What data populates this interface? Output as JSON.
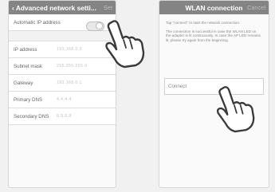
{
  "left_screen": {
    "back_label": "Advanced network setti...",
    "side_button": "Set",
    "auto_ip": {
      "label": "Automatic IP address",
      "toggle_value": "O"
    },
    "fields": [
      {
        "label": "IP address",
        "value": "192.168.0.3"
      },
      {
        "label": "Subnet mask",
        "value": "255.255.255.0"
      },
      {
        "label": "Gateway",
        "value": "192.168.0.1"
      },
      {
        "label": "Primary DNS",
        "value": "4.4.4.4"
      },
      {
        "label": "Secondary DNS",
        "value": "8.8.8.8"
      }
    ]
  },
  "right_screen": {
    "title": "WLAN connection",
    "side_button": "Cancel",
    "note_1": "Tap \"connect\" to start the network connection.",
    "note_2": "The connection is successful in case the WLAN LED on the adapter is lit continuously. In case the AP LED remains lit, please try again from the beginning.",
    "connect_label": "Connect"
  },
  "icons": [
    "tap-hand-icon"
  ],
  "colors": {
    "navbar": "#848484",
    "background": "#f1f1f1",
    "row_text": "#666666"
  }
}
